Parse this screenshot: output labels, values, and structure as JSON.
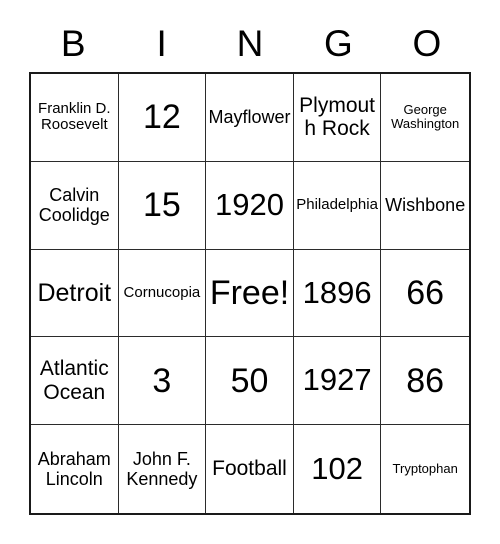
{
  "card": {
    "header_letters": [
      "B",
      "I",
      "N",
      "G",
      "O"
    ],
    "free_space_label": "Free!",
    "cells": [
      {
        "text": "Franklin D. Roosevelt",
        "size": "xs"
      },
      {
        "text": "12",
        "size": "xxl"
      },
      {
        "text": "Mayflower",
        "size": "s"
      },
      {
        "text": "Plymouth Rock",
        "size": "m"
      },
      {
        "text": "George Washington",
        "size": "xxs"
      },
      {
        "text": "Calvin Coolidge",
        "size": "s"
      },
      {
        "text": "15",
        "size": "xxl"
      },
      {
        "text": "1920",
        "size": "xl"
      },
      {
        "text": "Philadelphia",
        "size": "xs"
      },
      {
        "text": "Wishbone",
        "size": "s"
      },
      {
        "text": "Detroit",
        "size": "l"
      },
      {
        "text": "Cornucopia",
        "size": "xs"
      },
      {
        "text": "Free!",
        "size": "xxl"
      },
      {
        "text": "1896",
        "size": "xl"
      },
      {
        "text": "66",
        "size": "xxl"
      },
      {
        "text": "Atlantic Ocean",
        "size": "m"
      },
      {
        "text": "3",
        "size": "xxl"
      },
      {
        "text": "50",
        "size": "xxl"
      },
      {
        "text": "1927",
        "size": "xl"
      },
      {
        "text": "86",
        "size": "xxl"
      },
      {
        "text": "Abraham Lincoln",
        "size": "s"
      },
      {
        "text": "John F. Kennedy",
        "size": "s"
      },
      {
        "text": "Football",
        "size": "m"
      },
      {
        "text": "102",
        "size": "xl"
      },
      {
        "text": "Tryptophan",
        "size": "xxs"
      }
    ]
  },
  "colors": {
    "background": "#ffffff",
    "text": "#000000",
    "outer_border": "#1a1a1a",
    "inner_border": "#2b2b2b"
  }
}
